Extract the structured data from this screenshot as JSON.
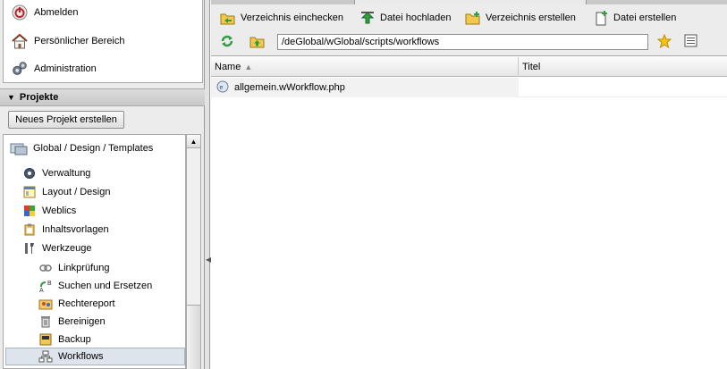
{
  "topnav": [
    {
      "label": "Abmelden",
      "icon": "power-icon"
    },
    {
      "label": "Persönlicher Bereich",
      "icon": "home-icon"
    },
    {
      "label": "Administration",
      "icon": "gears-icon"
    }
  ],
  "projects": {
    "header": "Projekte",
    "new_button": "Neues Projekt erstellen"
  },
  "tree": {
    "root": "Global / Design / Templates",
    "items": [
      {
        "label": "Verwaltung",
        "icon": "gear-icon"
      },
      {
        "label": "Layout / Design",
        "icon": "layout-icon"
      },
      {
        "label": "Weblics",
        "icon": "weblics-icon"
      },
      {
        "label": "Inhaltsvorlagen",
        "icon": "clipboard-icon"
      },
      {
        "label": "Werkzeuge",
        "icon": "tools-icon"
      },
      {
        "label": "Linkprüfung",
        "icon": "link-icon"
      },
      {
        "label": "Suchen und Ersetzen",
        "icon": "replace-icon"
      },
      {
        "label": "Rechtereport",
        "icon": "users-icon"
      },
      {
        "label": "Bereinigen",
        "icon": "trash-icon"
      },
      {
        "label": "Backup",
        "icon": "backup-icon"
      },
      {
        "label": "Workflows",
        "icon": "workflow-icon"
      }
    ]
  },
  "toolbar": {
    "checkin_dir": "Verzeichnis einchecken",
    "upload_file": "Datei hochladen",
    "create_dir": "Verzeichnis erstellen",
    "create_file": "Datei erstellen",
    "path": "/deGlobal/wGlobal/scripts/workflows"
  },
  "grid": {
    "columns": [
      "Name",
      "Titel"
    ],
    "rows": [
      {
        "name": "allgemein.wWorkflow.php",
        "title": ""
      }
    ]
  },
  "colors": {
    "panel_bg": "#ececec",
    "selected_bg": "#dde4ec",
    "folder_yellow": "#f2c94c",
    "green_refresh": "#2e9e3e"
  }
}
